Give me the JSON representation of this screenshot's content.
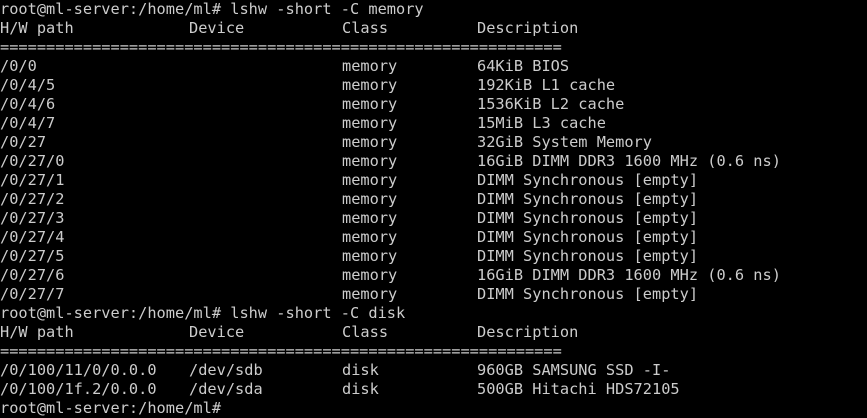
{
  "terminal": {
    "cmd1": "root@ml-server:/home/ml# lshw -short -C memory",
    "header1": {
      "path": "H/W path",
      "device": "Device",
      "class": "Class",
      "desc": "Description"
    },
    "sep1": "=============================================================",
    "rows1": [
      {
        "path": "/0/0",
        "device": "",
        "class": "memory",
        "desc": "64KiB BIOS"
      },
      {
        "path": "/0/4/5",
        "device": "",
        "class": "memory",
        "desc": "192KiB L1 cache"
      },
      {
        "path": "/0/4/6",
        "device": "",
        "class": "memory",
        "desc": "1536KiB L2 cache"
      },
      {
        "path": "/0/4/7",
        "device": "",
        "class": "memory",
        "desc": "15MiB L3 cache"
      },
      {
        "path": "/0/27",
        "device": "",
        "class": "memory",
        "desc": "32GiB System Memory"
      },
      {
        "path": "/0/27/0",
        "device": "",
        "class": "memory",
        "desc": "16GiB DIMM DDR3 1600 MHz (0.6 ns)"
      },
      {
        "path": "/0/27/1",
        "device": "",
        "class": "memory",
        "desc": "DIMM Synchronous [empty]"
      },
      {
        "path": "/0/27/2",
        "device": "",
        "class": "memory",
        "desc": "DIMM Synchronous [empty]"
      },
      {
        "path": "/0/27/3",
        "device": "",
        "class": "memory",
        "desc": "DIMM Synchronous [empty]"
      },
      {
        "path": "/0/27/4",
        "device": "",
        "class": "memory",
        "desc": "DIMM Synchronous [empty]"
      },
      {
        "path": "/0/27/5",
        "device": "",
        "class": "memory",
        "desc": "DIMM Synchronous [empty]"
      },
      {
        "path": "/0/27/6",
        "device": "",
        "class": "memory",
        "desc": "16GiB DIMM DDR3 1600 MHz (0.6 ns)"
      },
      {
        "path": "/0/27/7",
        "device": "",
        "class": "memory",
        "desc": "DIMM Synchronous [empty]"
      }
    ],
    "cmd2": "root@ml-server:/home/ml# lshw -short -C disk",
    "header2": {
      "path": "H/W path",
      "device": "Device",
      "class": "Class",
      "desc": "Description"
    },
    "sep2": "=============================================================",
    "rows2": [
      {
        "path": "/0/100/11/0/0.0.0",
        "device": "/dev/sdb",
        "class": "disk",
        "desc": "960GB SAMSUNG SSD -I-"
      },
      {
        "path": "/0/100/1f.2/0.0.0",
        "device": "/dev/sda",
        "class": "disk",
        "desc": "500GB Hitachi HDS72105"
      }
    ],
    "prompt": "root@ml-server:/home/ml#",
    "colors": {
      "background": "#000000",
      "foreground": "#cccccc"
    }
  }
}
